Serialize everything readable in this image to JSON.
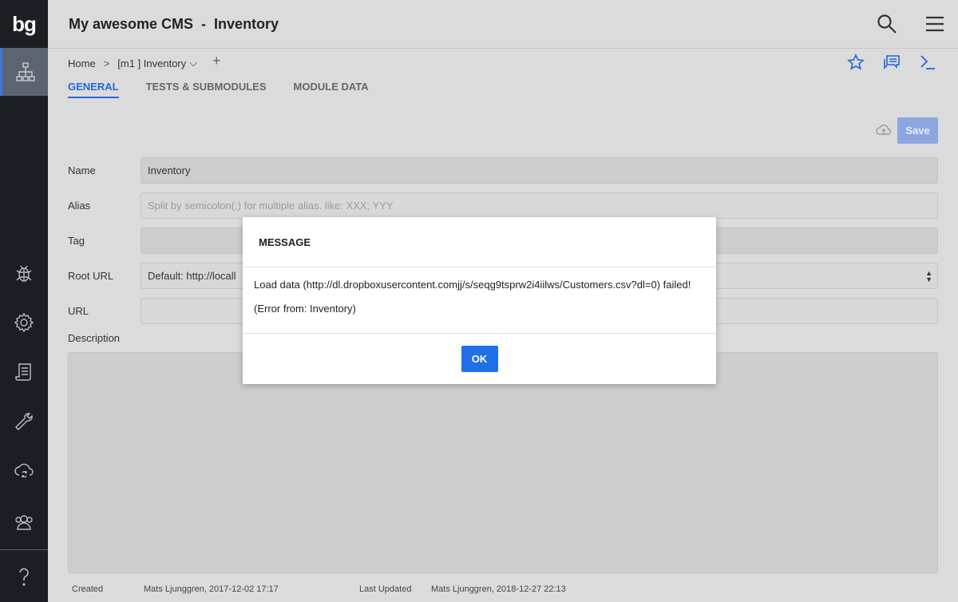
{
  "app": {
    "logo": "bg",
    "title": "My awesome CMS  -  Inventory"
  },
  "breadcrumb": {
    "home": "Home",
    "separator": ">",
    "current": "[m1 ] Inventory",
    "chevron": "⌵",
    "add": "+"
  },
  "tabs": [
    {
      "label": "GENERAL",
      "active": true
    },
    {
      "label": "TESTS & SUBMODULES",
      "active": false
    },
    {
      "label": "MODULE DATA",
      "active": false
    }
  ],
  "toolbar": {
    "save_label": "Save"
  },
  "form": {
    "name_label": "Name",
    "name_value": "Inventory",
    "alias_label": "Alias",
    "alias_placeholder": "Split by semicolon(;) for multiple alias. like: XXX; YYY",
    "tag_label": "Tag",
    "root_url_label": "Root URL",
    "root_url_value": "Default: http://locall",
    "url_label": "URL",
    "description_label": "Description"
  },
  "footer": {
    "created_label": "Created",
    "created_value": "Mats Ljunggren, 2017-12-02 17:17",
    "updated_label": "Last Updated",
    "updated_value": "Mats Ljunggren, 2018-12-27 22:13"
  },
  "modal": {
    "title": "MESSAGE",
    "message": "Load data (http://dl.dropboxusercontent.comjj/s/seqg9tsprw2i4iilws/Customers.csv?dl=0) failed!",
    "source": "(Error from: Inventory)",
    "ok_label": "OK"
  },
  "colors": {
    "accent": "#2366d8",
    "sidebar": "#1b1f24",
    "ok_button": "#1f6fe6"
  }
}
